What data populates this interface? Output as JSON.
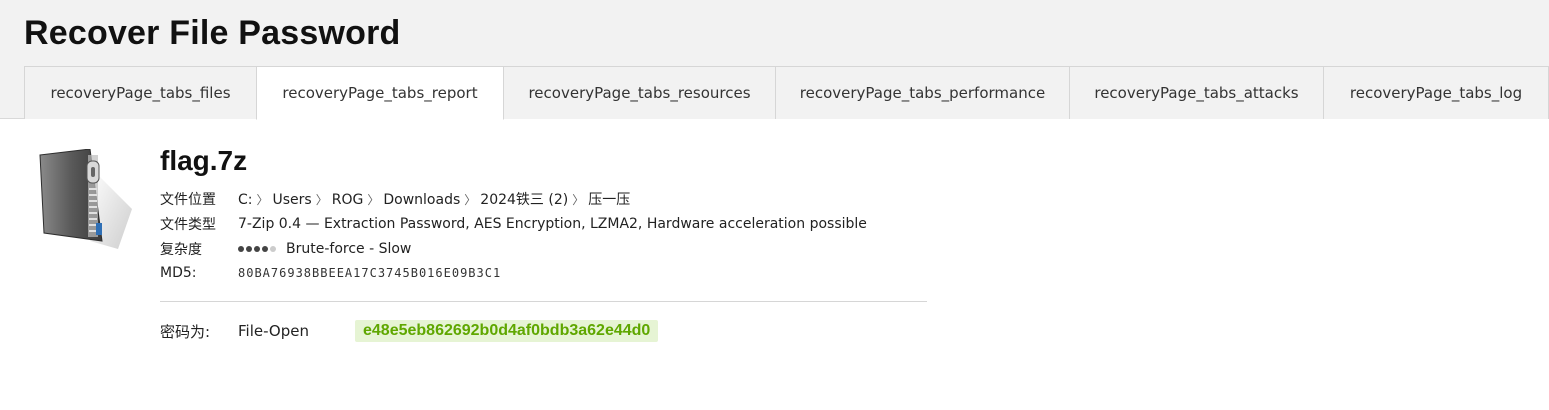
{
  "page": {
    "title": "Recover File Password"
  },
  "tabs": [
    {
      "label": "recoveryPage_tabs_files",
      "active": false
    },
    {
      "label": "recoveryPage_tabs_report",
      "active": true
    },
    {
      "label": "recoveryPage_tabs_resources",
      "active": false
    },
    {
      "label": "recoveryPage_tabs_performance",
      "active": false
    },
    {
      "label": "recoveryPage_tabs_attacks",
      "active": false
    },
    {
      "label": "recoveryPage_tabs_log",
      "active": false
    }
  ],
  "file": {
    "icon": "zip-archive-icon",
    "name": "flag.7z",
    "location_label": "文件位置",
    "location_path": [
      "C:",
      "Users",
      "ROG",
      "Downloads",
      "2024铁三 (2)",
      "压一压"
    ],
    "type_label": "文件类型",
    "type_value": "7-Zip 0.4 — Extraction Password, AES Encryption, LZMA2, Hardware acceleration possible",
    "complexity_label": "复杂度",
    "complexity_level": 4,
    "complexity_max": 5,
    "complexity_text": "Brute-force - Slow",
    "md5_label": "MD5:",
    "md5_value": "80BA76938BBEEA17C3745B016E09B3C1"
  },
  "password": {
    "label": "密码为:",
    "source": "File-Open",
    "value": "e48e5eb862692b0d4af0bdb3a62e44d0"
  },
  "colors": {
    "password_bg": "#e6f4d4",
    "password_text": "#5fa700",
    "header_bg": "#f2f2f2"
  }
}
